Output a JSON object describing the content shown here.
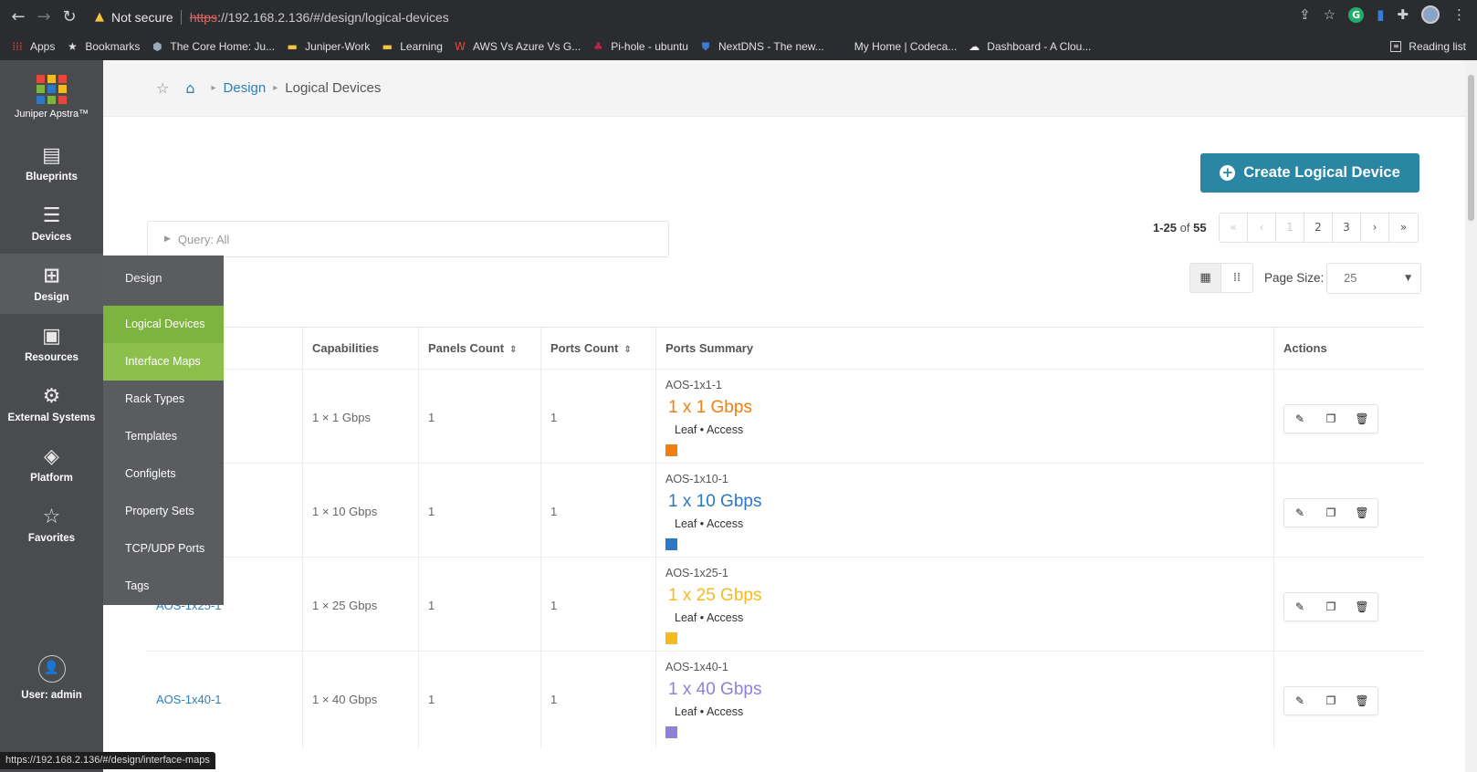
{
  "browser": {
    "security_label": "Not secure",
    "url_scheme": "https",
    "url_rest": "://192.168.2.136/#/design/logical-devices",
    "bookmarks": [
      {
        "label": "Apps",
        "icon": "apps-grid-icon",
        "color": "#e8453c"
      },
      {
        "label": "Bookmarks",
        "icon": "star-icon",
        "color": "#dddddd"
      },
      {
        "label": "The Core Home: Ju...",
        "icon": "hexagon-icon",
        "color": "#9ab"
      },
      {
        "label": "Juniper-Work",
        "icon": "folder-icon",
        "color": "#f4c542"
      },
      {
        "label": "Learning",
        "icon": "folder-icon",
        "color": "#f4c542"
      },
      {
        "label": "AWS Vs Azure Vs G...",
        "icon": "w-logo-icon",
        "color": "#e8453c"
      },
      {
        "label": "Pi-hole - ubuntu",
        "icon": "raspberry-icon",
        "color": "#c0234b"
      },
      {
        "label": "NextDNS - The new...",
        "icon": "shield-icon",
        "color": "#3a7bd5"
      },
      {
        "label": "My Home | Codeca...",
        "icon": "page-icon",
        "color": "#2a2f44"
      },
      {
        "label": "Dashboard - A Clou...",
        "icon": "cloud-icon",
        "color": "#f0f0f0"
      }
    ],
    "reading_list": "Reading list",
    "status_url": "https://192.168.2.136/#/design/interface-maps"
  },
  "sidebar": {
    "app_name": "Juniper Apstra™",
    "items": [
      {
        "label": "Blueprints",
        "icon": "blueprints-icon"
      },
      {
        "label": "Devices",
        "icon": "devices-icon"
      },
      {
        "label": "Design",
        "icon": "design-icon"
      },
      {
        "label": "Resources",
        "icon": "resources-icon"
      },
      {
        "label": "External Systems",
        "icon": "external-systems-icon"
      },
      {
        "label": "Platform",
        "icon": "platform-icon"
      },
      {
        "label": "Favorites",
        "icon": "star-icon"
      }
    ],
    "user": "User: admin"
  },
  "flyout": {
    "heading": "Design",
    "items": [
      "Logical Devices",
      "Interface Maps",
      "Rack Types",
      "Templates",
      "Configlets",
      "Property Sets",
      "TCP/UDP Ports",
      "Tags"
    ]
  },
  "breadcrumb": {
    "design": "Design",
    "current": "Logical Devices"
  },
  "create_button": "Create Logical Device",
  "query": "Query: All",
  "pagination": {
    "range": "1-25",
    "of": "of",
    "total": "55",
    "pages": [
      "«",
      "‹",
      "1",
      "2",
      "3",
      "›",
      "»"
    ]
  },
  "page_size": {
    "label": "Page Size:",
    "value": "25"
  },
  "table": {
    "headers": {
      "capabilities": "Capabilities",
      "panels_count": "Panels Count",
      "ports_count": "Ports Count",
      "ports_summary": "Ports Summary",
      "actions": "Actions"
    },
    "rows": [
      {
        "name": "",
        "capabilities": "1 × 1 Gbps",
        "panels": "1",
        "ports": "1",
        "ps_name": "AOS-1x1-1",
        "ps_speed": "1 x 1 Gbps",
        "ps_role": "Leaf • Access",
        "color": "#f07f0f"
      },
      {
        "name": "",
        "capabilities": "1 × 10 Gbps",
        "panels": "1",
        "ports": "1",
        "ps_name": "AOS-1x10-1",
        "ps_speed": "1 x 10 Gbps",
        "ps_role": "Leaf • Access",
        "color": "#2a78c6"
      },
      {
        "name": "AOS-1x25-1",
        "capabilities": "1 × 25 Gbps",
        "panels": "1",
        "ports": "1",
        "ps_name": "AOS-1x25-1",
        "ps_speed": "1 x 25 Gbps",
        "ps_role": "Leaf • Access",
        "color": "#f4bb1f"
      },
      {
        "name": "AOS-1x40-1",
        "capabilities": "1 × 40 Gbps",
        "panels": "1",
        "ports": "1",
        "ps_name": "AOS-1x40-1",
        "ps_speed": "1 x 40 Gbps",
        "ps_role": "Leaf • Access",
        "color": "#9180d8"
      }
    ]
  }
}
